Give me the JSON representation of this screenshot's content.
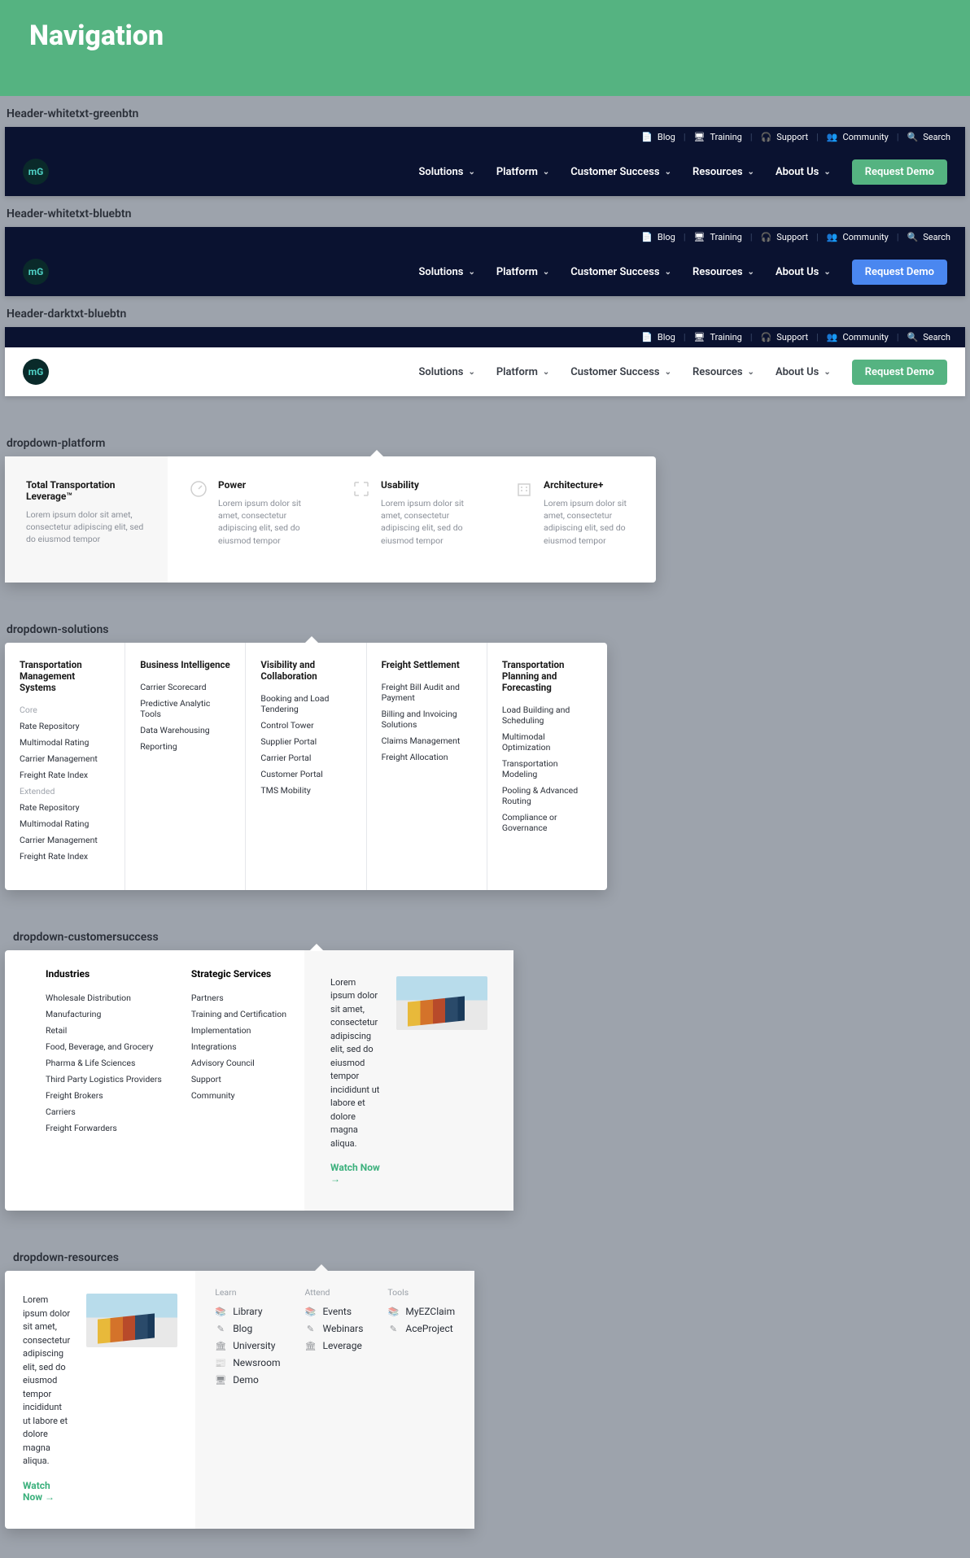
{
  "banner": {
    "title": "Navigation"
  },
  "section_labels": {
    "h1": "Header-whitetxt-greenbtn",
    "h2": "Header-whitetxt-bluebtn",
    "h3": "Header-darktxt-bluebtn",
    "d1": "dropdown-platform",
    "d2": "dropdown-solutions",
    "d3": "dropdown-customersuccess",
    "d4": "dropdown-resources"
  },
  "topbar": {
    "blog": "Blog",
    "training": "Training",
    "support": "Support",
    "community": "Community",
    "search": "Search"
  },
  "nav": {
    "solutions": "Solutions",
    "platform": "Platform",
    "customer_success": "Customer Success",
    "resources": "Resources",
    "about": "About Us",
    "cta": "Request Demo"
  },
  "dropdown_platform": {
    "col1": {
      "title": "Total Transportation Leverage™",
      "desc": "Lorem ipsum dolor sit amet, consectetur adipiscing elit, sed do eiusmod tempor"
    },
    "col2": {
      "title": "Power",
      "desc": "Lorem ipsum dolor sit amet, consectetur adipiscing elit, sed do eiusmod tempor"
    },
    "col3": {
      "title": "Usability",
      "desc": "Lorem ipsum dolor sit amet, consectetur adipiscing elit, sed do eiusmod tempor"
    },
    "col4": {
      "title": "Architecture+",
      "desc": "Lorem ipsum dolor sit amet, consectetur adipiscing elit, sed do eiusmod tempor"
    }
  },
  "dropdown_solutions": {
    "col1": {
      "title": "Transportation Management Systems",
      "sub1": "Core",
      "items1": [
        "Rate Repository",
        "Multimodal Rating",
        "Carrier Management",
        "Freight Rate Index"
      ],
      "sub2": "Extended",
      "items2": [
        "Rate Repository",
        "Multimodal Rating",
        "Carrier Management",
        "Freight Rate Index"
      ]
    },
    "col2": {
      "title": "Business Intelligence",
      "items": [
        "Carrier Scorecard",
        "Predictive Analytic Tools",
        "Data Warehousing",
        "Reporting"
      ]
    },
    "col3": {
      "title": "Visibility and Collaboration",
      "items": [
        "Booking and Load Tendering",
        "Control Tower",
        "Supplier Portal",
        "Carrier Portal",
        "Customer Portal",
        "TMS Mobility"
      ]
    },
    "col4": {
      "title": "Freight Settlement",
      "items": [
        "Freight Bill Audit and Payment",
        "Billing and Invoicing Solutions",
        "Claims Management",
        "Freight Allocation"
      ]
    },
    "col5": {
      "title": "Transportation Planning and Forecasting",
      "items": [
        "Load Building and Scheduling",
        "Multimodal Optimization",
        "Transportation Modeling",
        "Pooling & Advanced Routing",
        "Compliance or Governance"
      ]
    }
  },
  "dropdown_cs": {
    "col1": {
      "title": "Industries",
      "items": [
        "Wholesale Distribution",
        "Manufacturing",
        "Retail",
        "Food, Beverage, and Grocery",
        "Pharma & Life Sciences",
        "Third Party Logistics Providers",
        "Freight Brokers",
        "Carriers",
        "Freight Forwarders"
      ]
    },
    "col2": {
      "title": "Strategic Services",
      "items": [
        "Partners",
        "Training and Certification",
        "Implementation",
        "Integrations",
        "Advisory Council",
        "Support",
        "Community"
      ]
    },
    "promo": {
      "text": "Lorem ipsum dolor sit amet, consectetur adipiscing elit, sed do eiusmod tempor incididunt ut labore et dolore magna aliqua.",
      "watch": "Watch Now →"
    }
  },
  "dropdown_res": {
    "promo": {
      "text": "Lorem ipsum dolor sit amet, consectetur adipiscing elit, sed do eiusmod tempor incididunt ut labore et dolore magna aliqua.",
      "watch": "Watch Now →"
    },
    "col1": {
      "head": "Learn",
      "items": [
        "Library",
        "Blog",
        "University",
        "Newsroom",
        "Demo"
      ]
    },
    "col2": {
      "head": "Attend",
      "items": [
        "Events",
        "Webinars",
        "Leverage"
      ]
    },
    "col3": {
      "head": "Tools",
      "items": [
        "MyEZClaim",
        "AceProject"
      ]
    }
  }
}
